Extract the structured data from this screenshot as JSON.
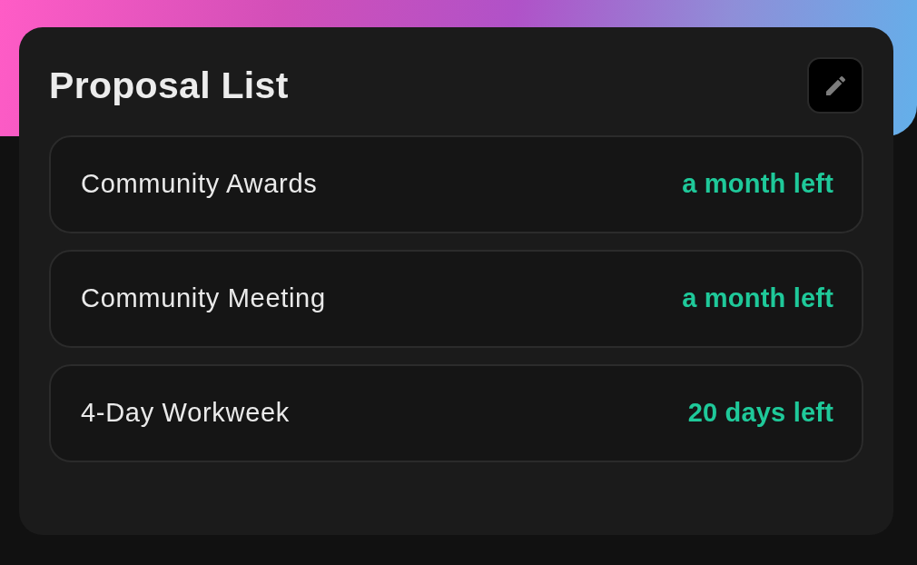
{
  "card": {
    "title": "Proposal List"
  },
  "proposals": [
    {
      "name": "Community Awards",
      "time_left": "a month left"
    },
    {
      "name": "Community Meeting",
      "time_left": "a month left"
    },
    {
      "name": "4-Day Workweek",
      "time_left": "20 days left"
    }
  ]
}
